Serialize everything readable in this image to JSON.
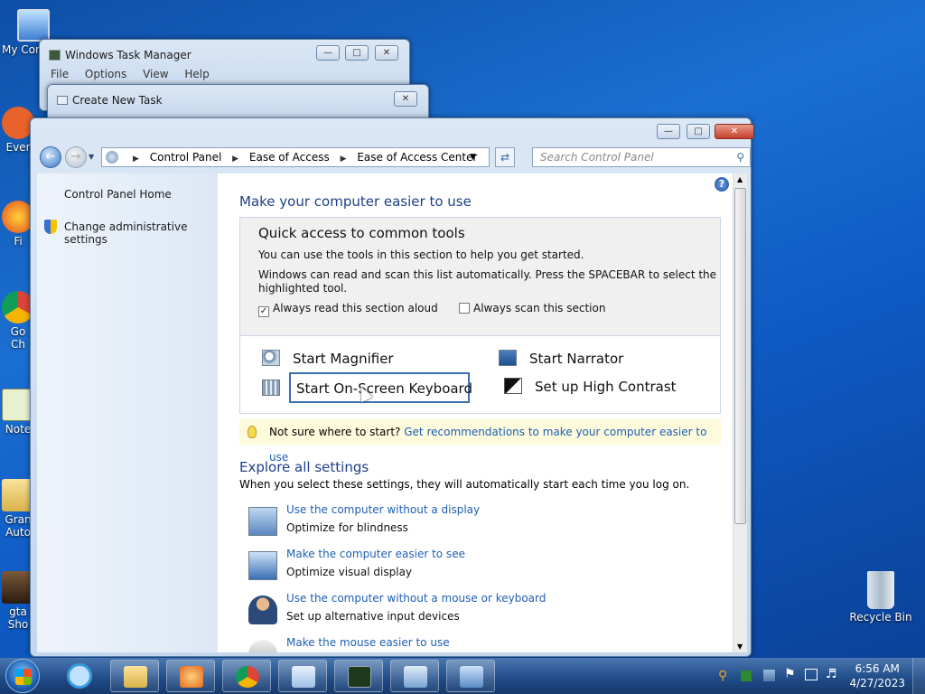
{
  "desktop": {
    "icons": [
      {
        "label": "My Con",
        "icon": "computer-icon"
      },
      {
        "label": "Ever",
        "icon": "app-shortcut-icon"
      },
      {
        "label": "Fi",
        "icon": "firefox-icon"
      },
      {
        "label": "Go\nCh",
        "icon": "chrome-icon"
      },
      {
        "label": "Note",
        "icon": "notepad-icon"
      },
      {
        "label": "Gran\nAuto",
        "icon": "folder-icon"
      },
      {
        "label": "gta\nSho",
        "icon": "game-shortcut-icon"
      }
    ],
    "recycle_bin": "Recycle Bin"
  },
  "task_manager": {
    "title": "Windows Task Manager",
    "menu": [
      "File",
      "Options",
      "View",
      "Help"
    ]
  },
  "create_task": {
    "title": "Create New Task"
  },
  "control_panel": {
    "breadcrumb": [
      "Control Panel",
      "Ease of Access",
      "Ease of Access Center"
    ],
    "search_placeholder": "Search Control Panel",
    "left_links": [
      "Control Panel Home",
      "Change administrative settings"
    ],
    "heading": "Make your computer easier to use",
    "quick": {
      "title": "Quick access to common tools",
      "line1": "You can use the tools in this section to help you get started.",
      "line2": "Windows can read and scan this list automatically.  Press the SPACEBAR to select the",
      "line3": "highlighted tool.",
      "check_read": "Always read this section aloud",
      "check_read_checked": true,
      "check_scan": "Always scan this section",
      "check_scan_checked": false
    },
    "tools": {
      "magnifier": "Start Magnifier",
      "narrator": "Start Narrator",
      "keyboard": "Start On-Screen Keyboard",
      "contrast": "Set up High Contrast"
    },
    "tip": {
      "text": "Not sure where to start?",
      "link": "Get recommendations to make your computer easier to use"
    },
    "explore": {
      "title": "Explore all settings",
      "subtitle": "When you select these settings, they will automatically start each time you log on.",
      "items": [
        {
          "link": "Use the computer without a display",
          "desc": "Optimize for blindness",
          "icon": "display-speaker-icon"
        },
        {
          "link": "Make the computer easier to see",
          "desc": "Optimize visual display",
          "icon": "magnify-monitor-icon"
        },
        {
          "link": "Use the computer without a mouse or keyboard",
          "desc": "Set up alternative input devices",
          "icon": "person-icon"
        },
        {
          "link": "Make the mouse easier to use",
          "desc": "",
          "icon": "mouse-icon"
        }
      ]
    }
  },
  "taskbar": {
    "time": "6:56 AM",
    "date": "4/27/2023",
    "apps": [
      "ie-icon",
      "explorer-icon",
      "media-player-icon",
      "chrome-icon",
      "notepad-icon",
      "task-manager-icon",
      "run-icon",
      "control-panel-icon"
    ]
  }
}
